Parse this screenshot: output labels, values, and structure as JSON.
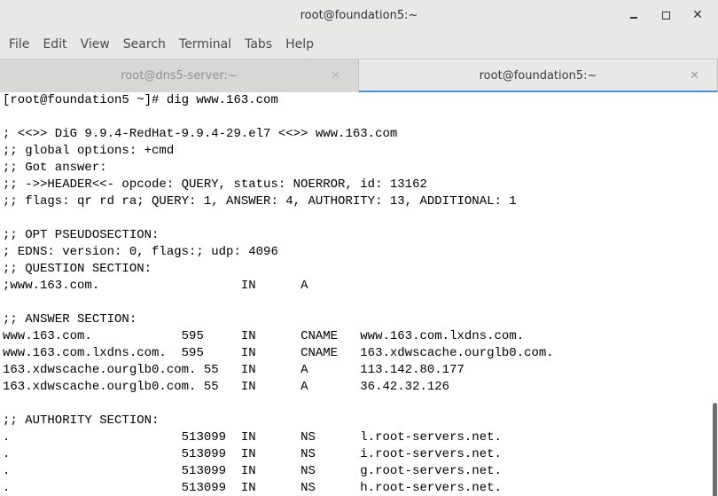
{
  "window": {
    "title": "root@foundation5:~",
    "minimize_glyph": "–",
    "maximize_glyph": "☐",
    "close_glyph": "✕"
  },
  "menu": [
    "File",
    "Edit",
    "View",
    "Search",
    "Terminal",
    "Tabs",
    "Help"
  ],
  "tabs": [
    {
      "label": "root@dns5-server:~",
      "active": false,
      "close_glyph": "✕"
    },
    {
      "label": "root@foundation5:~",
      "active": true,
      "close_glyph": "✕"
    }
  ],
  "terminal": {
    "lines": [
      "[root@foundation5 ~]# dig www.163.com",
      "",
      "; <<>> DiG 9.9.4-RedHat-9.9.4-29.el7 <<>> www.163.com",
      ";; global options: +cmd",
      ";; Got answer:",
      ";; ->>HEADER<<- opcode: QUERY, status: NOERROR, id: 13162",
      ";; flags: qr rd ra; QUERY: 1, ANSWER: 4, AUTHORITY: 13, ADDITIONAL: 1",
      "",
      ";; OPT PSEUDOSECTION:",
      "; EDNS: version: 0, flags:; udp: 4096",
      ";; QUESTION SECTION:",
      ";www.163.com.\t\t\tIN\tA",
      "",
      ";; ANSWER SECTION:",
      "www.163.com.\t\t595\tIN\tCNAME\twww.163.com.lxdns.com.",
      "www.163.com.lxdns.com.\t595\tIN\tCNAME\t163.xdwscache.ourglb0.com.",
      "163.xdwscache.ourglb0.com. 55\tIN\tA\t113.142.80.177",
      "163.xdwscache.ourglb0.com. 55\tIN\tA\t36.42.32.126",
      "",
      ";; AUTHORITY SECTION:",
      ".\t\t\t513099\tIN\tNS\tl.root-servers.net.",
      ".\t\t\t513099\tIN\tNS\ti.root-servers.net.",
      ".\t\t\t513099\tIN\tNS\tg.root-servers.net.",
      ".\t\t\t513099\tIN\tNS\th.root-servers.net."
    ]
  }
}
